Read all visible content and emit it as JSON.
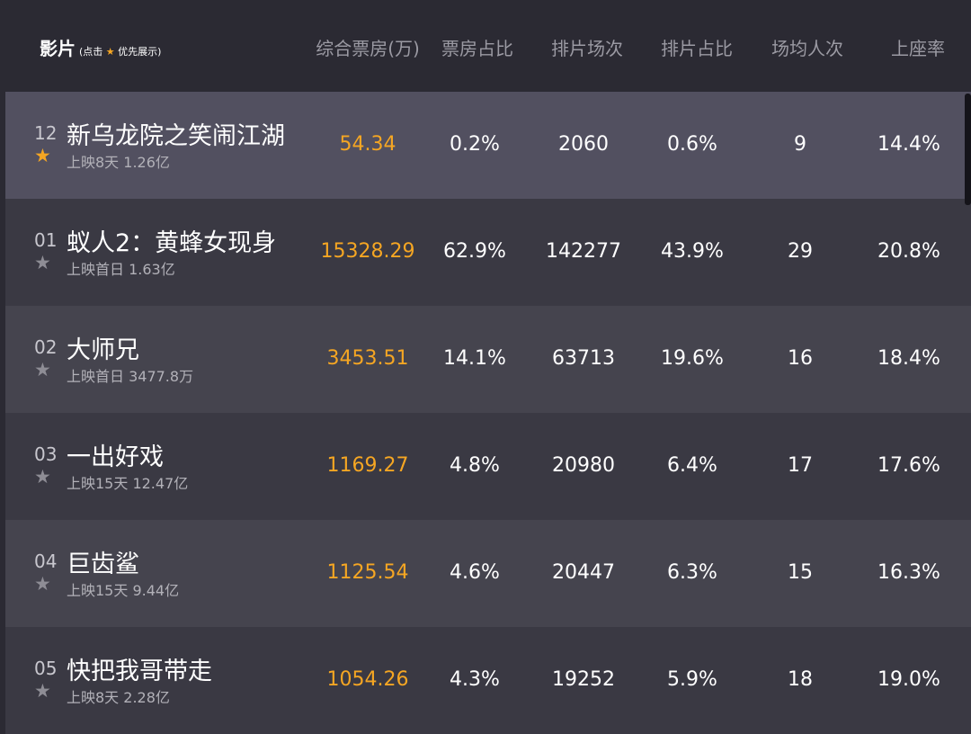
{
  "header": {
    "film": "影片",
    "note_prefix": "(点击",
    "note_suffix": "优先展示)",
    "columns": [
      "综合票房(万)",
      "票房占比",
      "排片场次",
      "排片占比",
      "场均人次",
      "上座率"
    ]
  },
  "accent": "#f5a623",
  "rows": [
    {
      "rank": "12",
      "title": "新乌龙院之笑闹江湖",
      "sub": "上映8天  1.26亿",
      "starred": true,
      "box": "54.34",
      "box_share": "0.2%",
      "shows": "2060",
      "show_share": "0.6%",
      "avg": "9",
      "rate": "14.4%"
    },
    {
      "rank": "01",
      "title": "蚁人2：黄蜂女现身",
      "sub": "上映首日  1.63亿",
      "starred": false,
      "box": "15328.29",
      "box_share": "62.9%",
      "shows": "142277",
      "show_share": "43.9%",
      "avg": "29",
      "rate": "20.8%"
    },
    {
      "rank": "02",
      "title": "大师兄",
      "sub": "上映首日  3477.8万",
      "starred": false,
      "box": "3453.51",
      "box_share": "14.1%",
      "shows": "63713",
      "show_share": "19.6%",
      "avg": "16",
      "rate": "18.4%"
    },
    {
      "rank": "03",
      "title": "一出好戏",
      "sub": "上映15天  12.47亿",
      "starred": false,
      "box": "1169.27",
      "box_share": "4.8%",
      "shows": "20980",
      "show_share": "6.4%",
      "avg": "17",
      "rate": "17.6%"
    },
    {
      "rank": "04",
      "title": "巨齿鲨",
      "sub": "上映15天  9.44亿",
      "starred": false,
      "box": "1125.54",
      "box_share": "4.6%",
      "shows": "20447",
      "show_share": "6.3%",
      "avg": "15",
      "rate": "16.3%"
    },
    {
      "rank": "05",
      "title": "快把我哥带走",
      "sub": "上映8天  2.28亿",
      "starred": false,
      "box": "1054.26",
      "box_share": "4.3%",
      "shows": "19252",
      "show_share": "5.9%",
      "avg": "18",
      "rate": "19.0%"
    }
  ]
}
